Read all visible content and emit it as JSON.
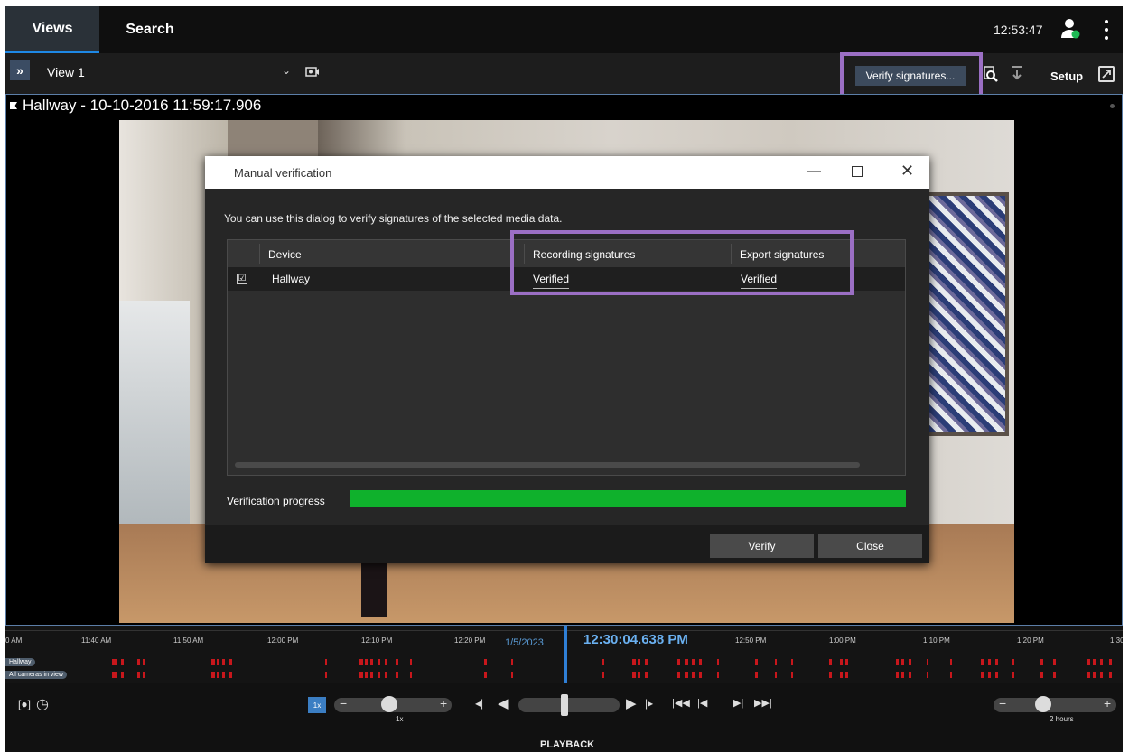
{
  "topbar": {
    "tabs": [
      {
        "label": "Views",
        "active": true
      },
      {
        "label": "Search",
        "active": false
      }
    ],
    "clock": "12:53:47",
    "user_status_color": "#1db954"
  },
  "viewbar": {
    "expand_label": "»",
    "view_name": "View 1",
    "verify_button": "Verify signatures...",
    "setup_label": "Setup"
  },
  "pane": {
    "title": "Hallway - 10-10-2016 11:59:17.906"
  },
  "dialog": {
    "title": "Manual verification",
    "description": "You can use this dialog to verify signatures of the selected media data.",
    "columns": [
      "Device",
      "Recording signatures",
      "Export signatures"
    ],
    "rows": [
      {
        "checked": true,
        "check_glyph": "☑",
        "device": "Hallway",
        "recording": "Verified",
        "export": "Verified"
      }
    ],
    "progress_label": "Verification progress",
    "progress_percent": 100,
    "progress_color": "#0fb12c",
    "verify_button": "Verify",
    "close_button": "Close"
  },
  "timeline": {
    "tick_labels": [
      "0 AM",
      "11:40 AM",
      "11:50 AM",
      "12:00 PM",
      "12:10 PM",
      "12:20 PM",
      "12:50 PM",
      "1:00 PM",
      "1:10 PM",
      "1:20 PM",
      "1:30"
    ],
    "date": "1/5/2023",
    "current_time": "12:30:04.638 PM",
    "tracks": [
      "Hallway",
      "All cameras in view"
    ],
    "recording_color": "#c8171c",
    "cursor_color": "#2f7fd6"
  },
  "controls": {
    "speed_badge": "1x",
    "speed_label": "1x",
    "range_label": "2 hours",
    "mode_label": "PLAYBACK",
    "icons": [
      "live-icon",
      "clock-icon",
      "prev-frame-icon",
      "reverse-play-icon",
      "play-icon",
      "next-frame-icon",
      "skip-start-icon",
      "prev-sequence-icon",
      "next-sequence-icon",
      "skip-end-icon"
    ]
  },
  "accent_colors": {
    "highlight": "#9b6fc4",
    "active_tab_underline": "#1e88e5"
  }
}
